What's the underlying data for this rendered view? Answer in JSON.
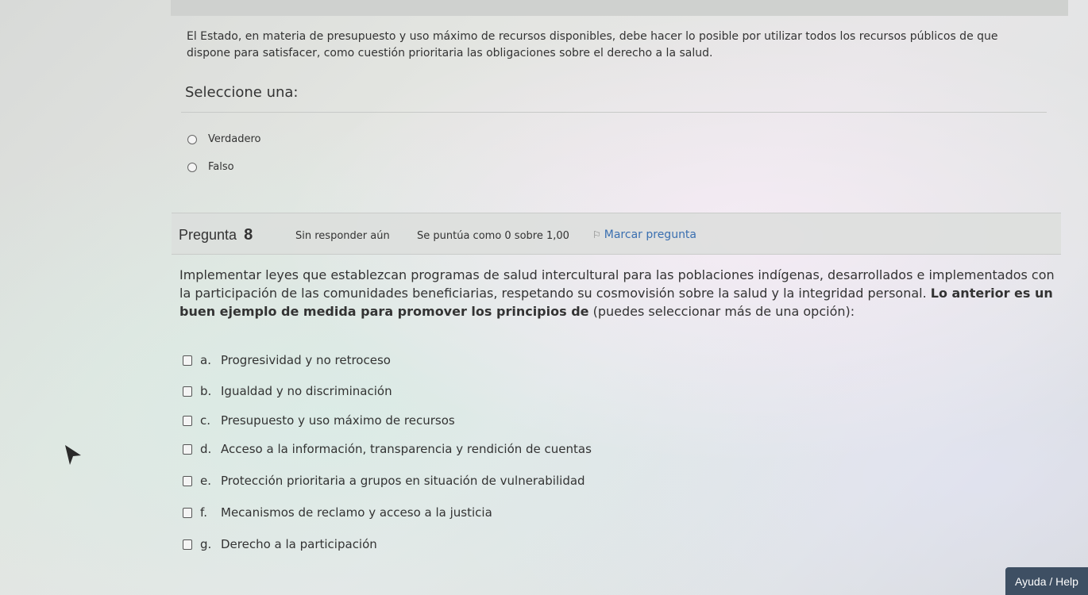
{
  "previous_question": {
    "text": "El Estado, en materia de presupuesto y uso máximo de recursos disponibles, debe hacer lo posible por utilizar todos los recursos públicos de que dispone para satisfacer, como cuestión prioritaria las obligaciones sobre el derecho a la salud.",
    "select_label": "Seleccione una:",
    "options": [
      "Verdadero",
      "Falso"
    ]
  },
  "question": {
    "label": "Pregunta",
    "number": "8",
    "state": "Sin responder aún",
    "grade": "Se puntúa como 0 sobre 1,00",
    "flag_label": "Marcar pregunta",
    "text_normal": "Implementar leyes que establezcan programas de salud intercultural para las poblaciones indígenas, desarrollados e implementados con la participación de las comunidades beneficiarias, respetando su cosmovisión sobre la salud y la integridad personal. ",
    "text_bold": "Lo anterior es un buen ejemplo de medida para promover los principios de",
    "text_tail": " (puedes seleccionar más de una opción):",
    "options": [
      {
        "letter": "a.",
        "text": "Progresividad y no retroceso"
      },
      {
        "letter": "b.",
        "text": "Igualdad y no discriminación"
      },
      {
        "letter": "c.",
        "text": "Presupuesto y uso máximo de recursos"
      },
      {
        "letter": "d.",
        "text": "Acceso a la información, transparencia y rendición de cuentas"
      },
      {
        "letter": "e.",
        "text": "Protección prioritaria a grupos en situación de vulnerabilidad"
      },
      {
        "letter": "f.",
        "text": "Mecanismos de reclamo y acceso a la justicia"
      },
      {
        "letter": "g.",
        "text": "Derecho a la participación"
      }
    ]
  },
  "help_button": "Ayuda / Help",
  "icons": {
    "flag": "flag-icon",
    "cursor": "mouse-pointer-icon"
  }
}
